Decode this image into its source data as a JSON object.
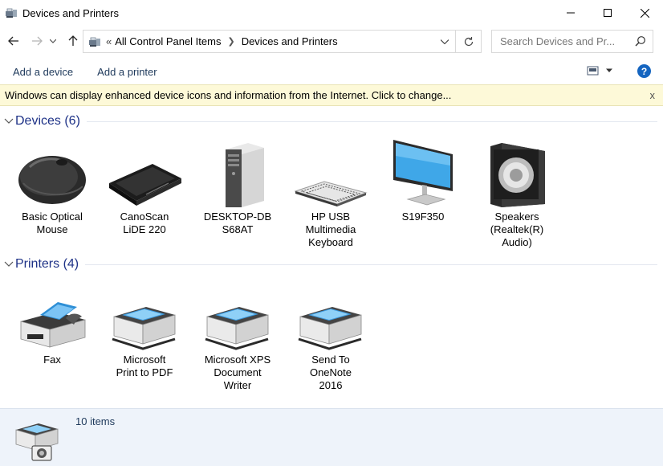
{
  "window": {
    "title": "Devices and Printers"
  },
  "address": {
    "overflow": "«",
    "crumbs": [
      "All Control Panel Items",
      "Devices and Printers"
    ]
  },
  "search": {
    "placeholder": "Search Devices and Pr..."
  },
  "toolbar": {
    "add_device": "Add a device",
    "add_printer": "Add a printer",
    "help": "?"
  },
  "infobar": {
    "message": "Windows can display enhanced device icons and information from the Internet. Click to change...",
    "close": "x"
  },
  "groups": {
    "devices": {
      "title": "Devices (6)",
      "items": [
        {
          "label": "Basic Optical\nMouse",
          "icon": "mouse-icon"
        },
        {
          "label": "CanoScan\nLiDE 220",
          "icon": "scanner-icon"
        },
        {
          "label": "DESKTOP-DB\nS68AT",
          "icon": "computer-tower-icon"
        },
        {
          "label": "HP USB\nMultimedia\nKeyboard",
          "icon": "keyboard-icon"
        },
        {
          "label": "S19F350",
          "icon": "monitor-icon"
        },
        {
          "label": "Speakers\n(Realtek(R)\nAudio)",
          "icon": "speaker-icon"
        }
      ]
    },
    "printers": {
      "title": "Printers (4)",
      "items": [
        {
          "label": "Fax",
          "icon": "fax-icon"
        },
        {
          "label": "Microsoft\nPrint to PDF",
          "icon": "printer-icon"
        },
        {
          "label": "Microsoft XPS\nDocument\nWriter",
          "icon": "printer-icon"
        },
        {
          "label": "Send To\nOneNote\n2016",
          "icon": "printer-icon"
        }
      ]
    }
  },
  "details": {
    "count": "10 items"
  },
  "colors": {
    "link": "#1e395b",
    "group_title": "#1e3287",
    "infobar_bg": "#fdf9d8",
    "details_bg": "#eef3fa"
  }
}
